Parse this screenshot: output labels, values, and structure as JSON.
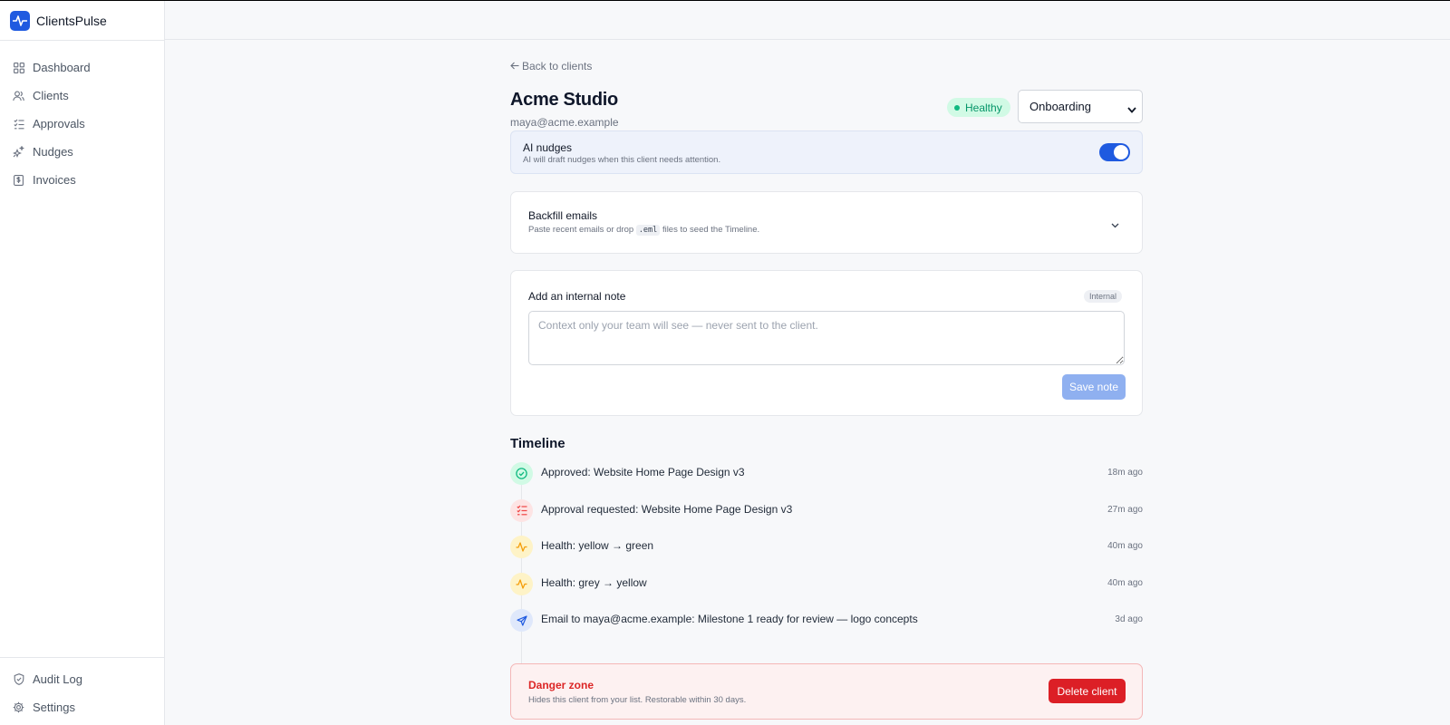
{
  "app": {
    "name": "ClientsPulse",
    "logo_icon": "pulse-icon",
    "accent": "#1f5ae0"
  },
  "sidebar": {
    "items": [
      {
        "label": "Dashboard",
        "icon": "grid-icon"
      },
      {
        "label": "Clients",
        "icon": "users-icon"
      },
      {
        "label": "Approvals",
        "icon": "checklist-icon"
      },
      {
        "label": "Nudges",
        "icon": "sparkle-icon"
      },
      {
        "label": "Invoices",
        "icon": "dollar-doc-icon"
      }
    ],
    "bottom_items": [
      {
        "label": "Audit Log",
        "icon": "shield-check-icon"
      },
      {
        "label": "Settings",
        "icon": "gear-icon"
      }
    ]
  },
  "client": {
    "back_label": "Back to clients",
    "name": "Acme Studio",
    "email": "maya@acme.example",
    "health": {
      "label": "Healthy",
      "color": "#10b981"
    },
    "stage": {
      "selected": "Onboarding"
    }
  },
  "ai_nudges": {
    "title": "AI nudges",
    "subtitle": "AI will draft nudges when this client needs attention.",
    "enabled": true
  },
  "backfill": {
    "title": "Backfill emails",
    "subtitle_before": "Paste recent emails or drop",
    "subtitle_code": ".eml",
    "subtitle_after": "files to seed the Timeline."
  },
  "note": {
    "label": "Add an internal note",
    "chip": "Internal",
    "placeholder": "Context only your team will see — never sent to the client.",
    "value": "",
    "save_label": "Save note"
  },
  "timeline": {
    "title": "Timeline",
    "items": [
      {
        "text": "Approved: Website Home Page Design v3",
        "time": "18m ago",
        "icon": "check-circle-icon",
        "color": "#10b981"
      },
      {
        "text": "Approval requested: Website Home Page Design v3",
        "time": "27m ago",
        "icon": "checklist-icon",
        "color": "#ef4444"
      },
      {
        "text": "Health: yellow → green",
        "time": "40m ago",
        "icon": "activity-icon",
        "color": "#f59e0b"
      },
      {
        "text": "Health: grey → yellow",
        "time": "40m ago",
        "icon": "activity-icon",
        "color": "#f59e0b"
      },
      {
        "text": "Email to maya@acme.example: Milestone 1 ready for review — logo concepts",
        "time": "3d ago",
        "icon": "send-icon",
        "color": "#1f5ae0"
      }
    ]
  },
  "danger_zone": {
    "title": "Danger zone",
    "subtitle": "Hides this client from your list. Restorable within 30 days.",
    "button_label": "Delete client"
  }
}
